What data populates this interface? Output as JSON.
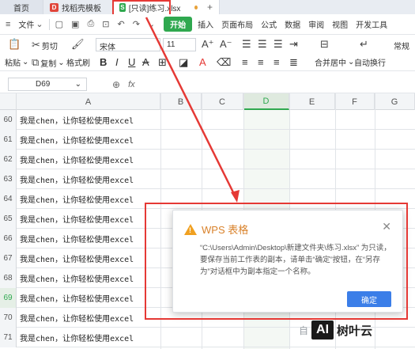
{
  "tabs": {
    "home": "首页",
    "template": "找稻壳模板",
    "file": "[只读]练习.xlsx"
  },
  "menu": {
    "file": "文件",
    "start": "开始",
    "items": [
      "插入",
      "页面布局",
      "公式",
      "数据",
      "审阅",
      "视图",
      "开发工具"
    ]
  },
  "ribbon": {
    "paste": "粘贴",
    "cut": "剪切",
    "copy": "复制",
    "format_painter": "格式刷",
    "font": "宋体",
    "size": "11",
    "merge": "合并居中",
    "wrap": "自动换行",
    "number_format": "常规"
  },
  "formula_bar": {
    "name_box": "D69",
    "fx": "fx"
  },
  "grid": {
    "columns": [
      "A",
      "B",
      "C",
      "D",
      "E",
      "F",
      "G"
    ],
    "selected_column": "D",
    "selected_row": "69",
    "rows": [
      {
        "num": "60",
        "a": "我是chen，让你轻松使用excel"
      },
      {
        "num": "61",
        "a": "我是chen，让你轻松使用excel"
      },
      {
        "num": "62",
        "a": "我是chen，让你轻松使用excel"
      },
      {
        "num": "63",
        "a": "我是chen，让你轻松使用excel"
      },
      {
        "num": "64",
        "a": "我是chen，让你轻松使用excel"
      },
      {
        "num": "65",
        "a": "我是chen，让你轻松使用excel"
      },
      {
        "num": "66",
        "a": "我是chen，让你轻松使用excel"
      },
      {
        "num": "67",
        "a": "我是chen，让你轻松使用excel"
      },
      {
        "num": "68",
        "a": "我是chen，让你轻松使用excel"
      },
      {
        "num": "69",
        "a": "我是chen，让你轻松使用excel"
      },
      {
        "num": "70",
        "a": "我是chen，让你轻松使用excel"
      },
      {
        "num": "71",
        "a": "我是chen，让你轻松使用excel"
      },
      {
        "num": "72",
        "a": "我是chen，让你轻松使用excel"
      }
    ]
  },
  "dialog": {
    "title": "WPS 表格",
    "message": "“C:\\Users\\Admin\\Desktop\\新建文件夹\\练习.xlsx” 为只读，要保存当前工作表的副本，请单击“确定”按钮，在“另存为”对话框中为副本指定一个名称。",
    "ok": "确定"
  },
  "watermark": {
    "text": "自",
    "logo": "AI",
    "brand": "树叶云"
  },
  "colors": {
    "accent": "#2fa84f",
    "annotation": "#e53935",
    "dialog_button": "#3b7ee8",
    "warning": "#f0a020"
  }
}
